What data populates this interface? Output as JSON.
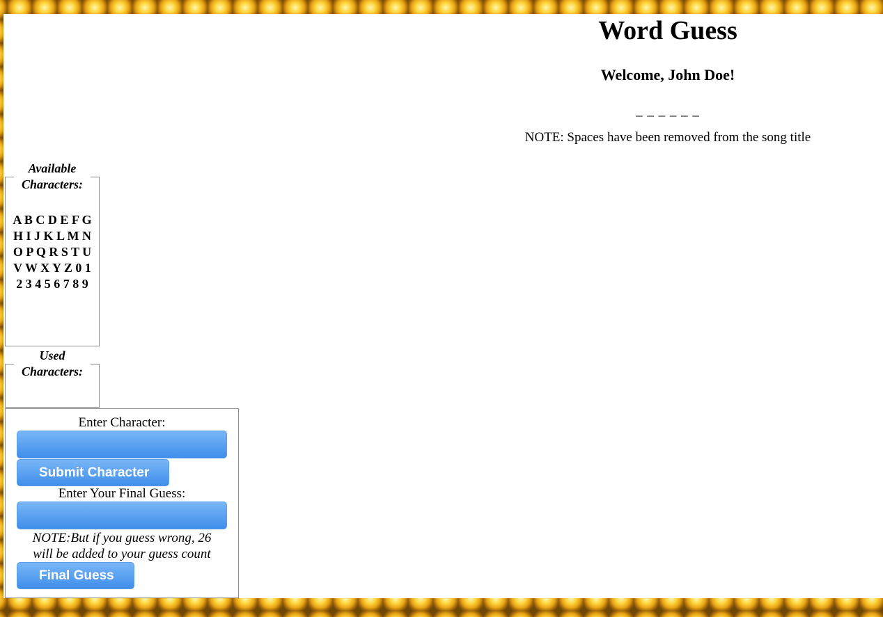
{
  "header": {
    "title": "Word Guess",
    "welcome": "Welcome, John Doe!",
    "blanks": "_ _ _ _ _ _",
    "note": "NOTE: Spaces have been removed from the song title"
  },
  "available": {
    "legend": "Available Characters:",
    "characters": "A B C D E F G H I J K L M N O P Q R S T U V W X Y Z 0 1 2 3 4 5 6 7 8 9"
  },
  "used": {
    "legend": "Used Characters:",
    "characters": ""
  },
  "form": {
    "character_label": "Enter Character:",
    "character_value": "",
    "submit_label": "Submit Character",
    "final_label": "Enter Your Final Guess:",
    "final_value": "",
    "final_note": "NOTE:But if you guess wrong, 26 will be added to your guess count",
    "final_button": "Final Guess"
  },
  "colors": {
    "button_top": "#79b6f6",
    "button_bottom": "#3f8eeb",
    "border_background": "#d9a21a"
  }
}
